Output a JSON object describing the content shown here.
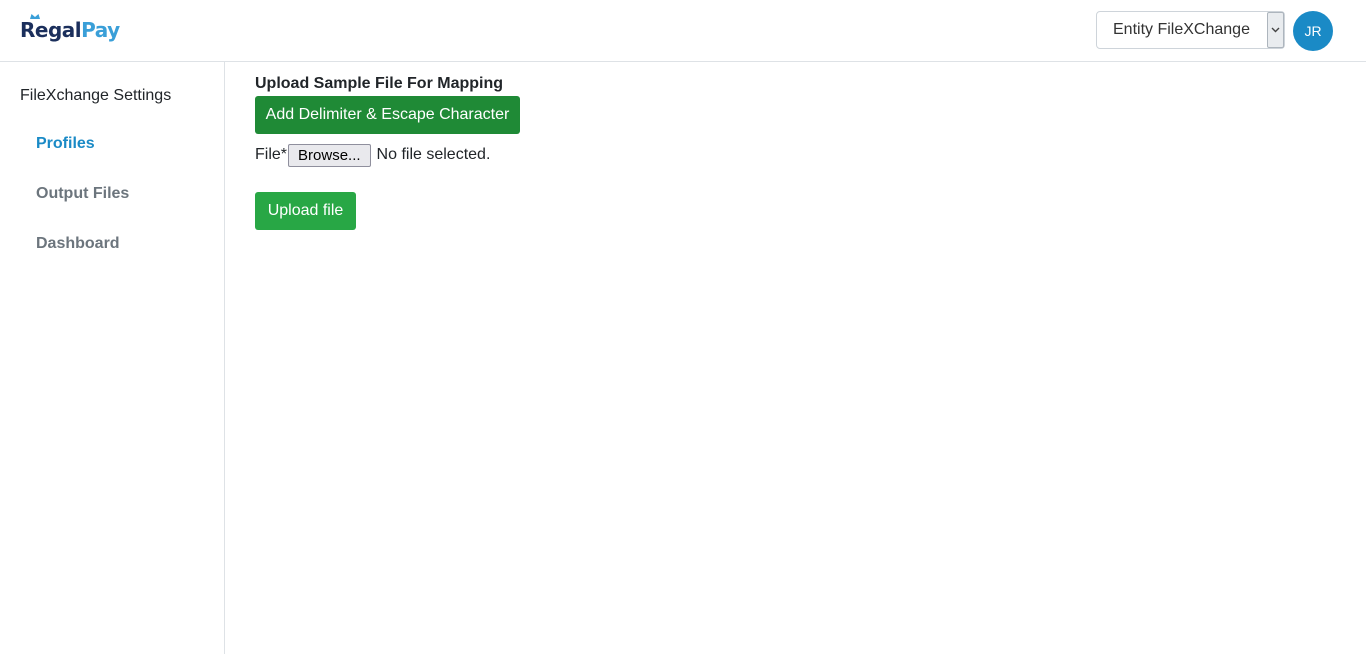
{
  "header": {
    "logo_part1": "Regal",
    "logo_part2": "Pay",
    "entity_select": {
      "value": "Entity FileXChange"
    },
    "avatar_initials": "JR"
  },
  "sidebar": {
    "title": "FileXchange Settings",
    "items": [
      {
        "label": "Profiles",
        "active": true
      },
      {
        "label": "Output Files",
        "active": false
      },
      {
        "label": "Dashboard",
        "active": false
      }
    ]
  },
  "main": {
    "heading": "Upload Sample File For Mapping",
    "delimiter_button": "Add Delimiter & Escape Character",
    "file_label": "File*",
    "browse_button": "Browse...",
    "file_status": "No file selected.",
    "upload_button": "Upload file"
  },
  "colors": {
    "brand_navy": "#1b2f5c",
    "brand_blue": "#3a9fd8",
    "accent": "#1a8ac6",
    "dark_green": "#1f8a36",
    "green": "#28a745"
  }
}
